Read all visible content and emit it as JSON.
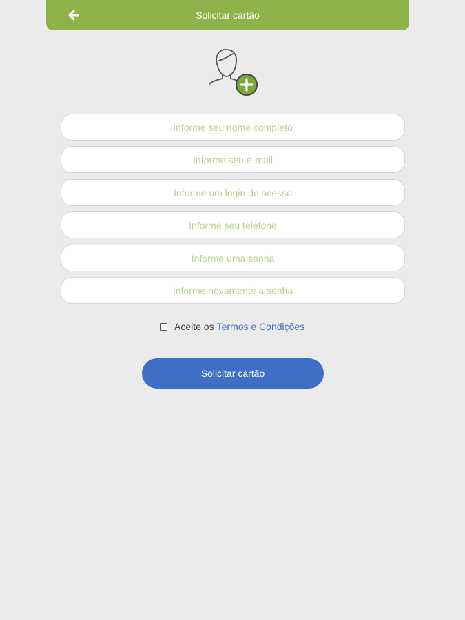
{
  "header": {
    "title": "Solicitar cartão",
    "back_icon": "arrow-left-icon",
    "background_color": "#8db24a"
  },
  "avatar": {
    "icon": "add-user-icon",
    "badge_color": "#7aa63a"
  },
  "form": {
    "fields": [
      {
        "placeholder": "Informe seu nome completo",
        "value": ""
      },
      {
        "placeholder": "Informe seu e-mail",
        "value": ""
      },
      {
        "placeholder": "Informe um login de acesso",
        "value": ""
      },
      {
        "placeholder": "Informe seu telefone",
        "value": ""
      },
      {
        "placeholder": "Informe uma senha",
        "value": ""
      },
      {
        "placeholder": "Informe novamente a senha",
        "value": ""
      }
    ],
    "placeholder_color": "#b9d38f"
  },
  "terms": {
    "checked": false,
    "prefix": "Aceite os",
    "link": "Termos e Condições",
    "link_color": "#3d6fc4"
  },
  "submit": {
    "label": "Solicitar cartão",
    "color": "#3f6fc4"
  }
}
